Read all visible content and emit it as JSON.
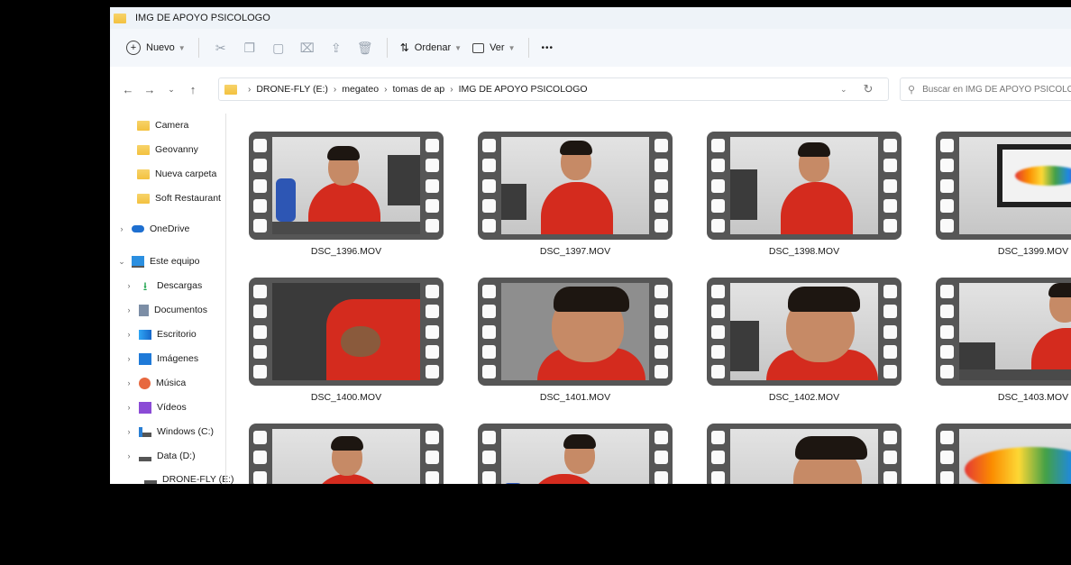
{
  "window": {
    "title": "IMG DE APOYO PSICOLOGO"
  },
  "toolbar": {
    "new_label": "Nuevo",
    "sort_label": "Ordenar",
    "view_label": "Ver",
    "more_label": "•••"
  },
  "address": {
    "crumbs": [
      "DRONE-FLY (E:)",
      "megateo",
      "tomas de ap",
      "IMG DE APOYO PSICOLOGO"
    ],
    "search_placeholder": "Buscar en IMG DE APOYO PSICOLOGO"
  },
  "sidebar": {
    "items": [
      {
        "label": "Camera",
        "icon": "folder-icon"
      },
      {
        "label": "Geovanny",
        "icon": "folder-icon"
      },
      {
        "label": "Nueva carpeta",
        "icon": "folder-icon"
      },
      {
        "label": "Soft Restaurant",
        "icon": "folder-icon"
      },
      {
        "label": "OneDrive",
        "icon": "cloud-icon"
      },
      {
        "label": "Este equipo",
        "icon": "computer-icon"
      },
      {
        "label": "Descargas",
        "icon": "download-icon"
      },
      {
        "label": "Documentos",
        "icon": "documents-icon"
      },
      {
        "label": "Escritorio",
        "icon": "desktop-icon"
      },
      {
        "label": "Imágenes",
        "icon": "pictures-icon"
      },
      {
        "label": "Música",
        "icon": "music-icon"
      },
      {
        "label": "Vídeos",
        "icon": "videos-icon"
      },
      {
        "label": "Windows (C:)",
        "icon": "windows-drive-icon"
      },
      {
        "label": "Data (D:)",
        "icon": "drive-icon"
      },
      {
        "label": "DRONE-FLY (E:)",
        "icon": "drive-icon"
      }
    ]
  },
  "files": [
    {
      "name": "DSC_1396.MOV"
    },
    {
      "name": "DSC_1397.MOV"
    },
    {
      "name": "DSC_1398.MOV"
    },
    {
      "name": "DSC_1399.MOV"
    },
    {
      "name": "DSC_1400.MOV"
    },
    {
      "name": "DSC_1401.MOV"
    },
    {
      "name": "DSC_1402.MOV"
    },
    {
      "name": "DSC_1403.MOV"
    },
    {
      "name": ""
    },
    {
      "name": ""
    },
    {
      "name": ""
    },
    {
      "name": ""
    }
  ],
  "colors": {
    "accent": "#0067c0",
    "folder": "#f3c13f"
  }
}
